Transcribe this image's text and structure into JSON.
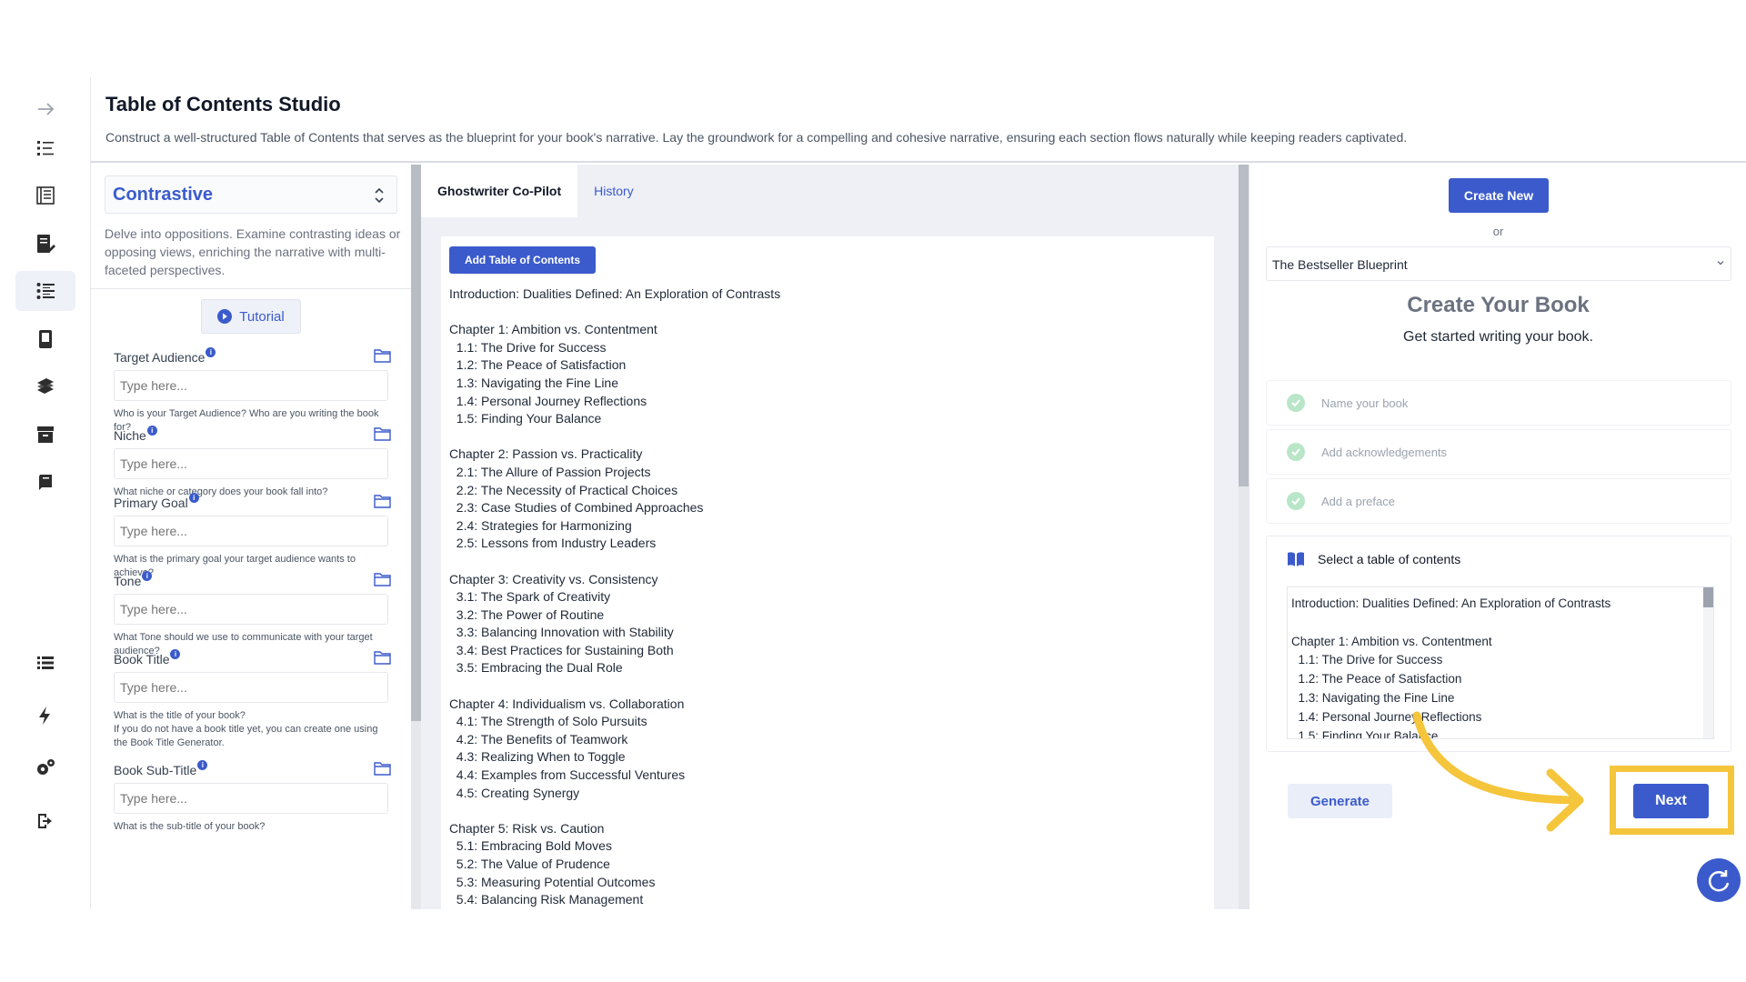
{
  "header": {
    "title": "Table of Contents Studio",
    "description": "Construct a well-structured Table of Contents that serves as the blueprint for your book's narrative. Lay the groundwork for a compelling and cohesive narrative, ensuring each section flows naturally while keeping readers captivated."
  },
  "rail": {
    "icons": [
      "arrow-right-icon",
      "numbered-list-icon",
      "book-list-icon",
      "document-edit-icon",
      "list-icon",
      "book-icon",
      "books-stack-icon",
      "archive-icon",
      "notebook-icon",
      "menu-list-icon",
      "lightning-icon",
      "settings-icon",
      "logout-icon"
    ]
  },
  "form": {
    "style_value": "Contrastive",
    "style_description": "Delve into oppositions. Examine contrasting ideas or opposing views, enriching the narrative with multi-faceted perspectives.",
    "tutorial_label": "Tutorial",
    "info_glyph": "i",
    "fields": [
      {
        "label": "Target Audience",
        "placeholder": "Type here...",
        "hint": "Who is your Target Audience? Who are you writing the book for?"
      },
      {
        "label": "Niche",
        "placeholder": "Type here...",
        "hint": "What niche or category does your book fall into?"
      },
      {
        "label": "Primary Goal",
        "placeholder": "Type here...",
        "hint": "What is the primary goal your target audience wants to achieve?"
      },
      {
        "label": "Tone",
        "placeholder": "Type here...",
        "hint": "What Tone should we use to communicate with your target audience?"
      },
      {
        "label": "Book Title",
        "placeholder": "Type here...",
        "hint": "What is the title of your book?\nIf you do not have a book title yet, you can create one using the Book Title Generator."
      },
      {
        "label": "Book Sub-Title",
        "placeholder": "Type here...",
        "hint": "What is the sub-title of your book?"
      }
    ]
  },
  "middle": {
    "tabs": [
      "Ghostwriter Co-Pilot",
      "History"
    ],
    "add_toc_label": "Add Table of Contents",
    "toc_text": "Introduction: Dualities Defined: An Exploration of Contrasts\n\nChapter 1: Ambition vs. Contentment\n  1.1: The Drive for Success\n  1.2: The Peace of Satisfaction\n  1.3: Navigating the Fine Line\n  1.4: Personal Journey Reflections\n  1.5: Finding Your Balance\n\nChapter 2: Passion vs. Practicality\n  2.1: The Allure of Passion Projects\n  2.2: The Necessity of Practical Choices\n  2.3: Case Studies of Combined Approaches\n  2.4: Strategies for Harmonizing\n  2.5: Lessons from Industry Leaders\n\nChapter 3: Creativity vs. Consistency\n  3.1: The Spark of Creativity\n  3.2: The Power of Routine\n  3.3: Balancing Innovation with Stability\n  3.4: Best Practices for Sustaining Both\n  3.5: Embracing the Dual Role\n\nChapter 4: Individualism vs. Collaboration\n  4.1: The Strength of Solo Pursuits\n  4.2: The Benefits of Teamwork\n  4.3: Realizing When to Toggle\n  4.4: Examples from Successful Ventures\n  4.5: Creating Synergy\n\nChapter 5: Risk vs. Caution\n  5.1: Embracing Bold Moves\n  5.2: The Value of Prudence\n  5.3: Measuring Potential Outcomes\n  5.4: Balancing Risk Management"
  },
  "right": {
    "create_new_label": "Create New",
    "or_label": "or",
    "template_value": "The Bestseller Blueprint",
    "create_title": "Create Your Book",
    "create_subtitle": "Get started writing your book.",
    "steps": [
      "Name your book",
      "Add acknowledgements",
      "Add a preface"
    ],
    "toc_card_title": "Select a table of contents",
    "toc_preview": "Introduction: Dualities Defined: An Exploration of Contrasts\n\nChapter 1: Ambition vs. Contentment\n  1.1: The Drive for Success\n  1.2: The Peace of Satisfaction\n  1.3: Navigating the Fine Line\n  1.4: Personal Journey Reflections\n  1.5: Finding Your Balance",
    "generate_label": "Generate",
    "next_label": "Next"
  },
  "colors": {
    "accent": "#3b5bcc",
    "highlight": "#f5c53c",
    "check": "#b9e6c8"
  }
}
